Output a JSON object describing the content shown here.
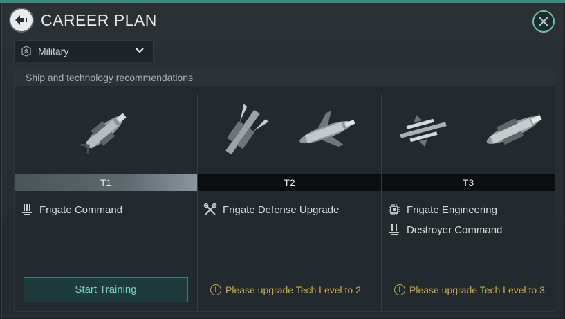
{
  "header": {
    "title": "CAREER PLAN",
    "back_icon": "back-arrow-icon",
    "close_icon": "close-icon"
  },
  "dropdown": {
    "selected": "Military",
    "icon": "military-icon"
  },
  "panel": {
    "heading": "Ship and technology recommendations"
  },
  "tiers": [
    {
      "label": "T1",
      "ships": [
        "frigate-ship"
      ],
      "skills": [
        {
          "name": "Frigate Command",
          "icon": "command-icon"
        }
      ],
      "action": {
        "type": "button",
        "label": "Start Training"
      }
    },
    {
      "label": "T2",
      "ships": [
        "destroyer-ship",
        "frigate-ship"
      ],
      "skills": [
        {
          "name": "Frigate Defense Upgrade",
          "icon": "wrench-icon"
        }
      ],
      "action": {
        "type": "warning",
        "label": "Please upgrade Tech Level to 2"
      }
    },
    {
      "label": "T3",
      "ships": [
        "frigate-ship",
        "destroyer-ship"
      ],
      "skills": [
        {
          "name": "Frigate Engineering",
          "icon": "chip-icon"
        },
        {
          "name": "Destroyer Command",
          "icon": "command-icon"
        }
      ],
      "action": {
        "type": "warning",
        "label": "Please upgrade Tech Level to 3"
      }
    }
  ],
  "colors": {
    "accent": "#66c2b4",
    "warning": "#c9a94a",
    "button_text": "#6fd6c4"
  }
}
